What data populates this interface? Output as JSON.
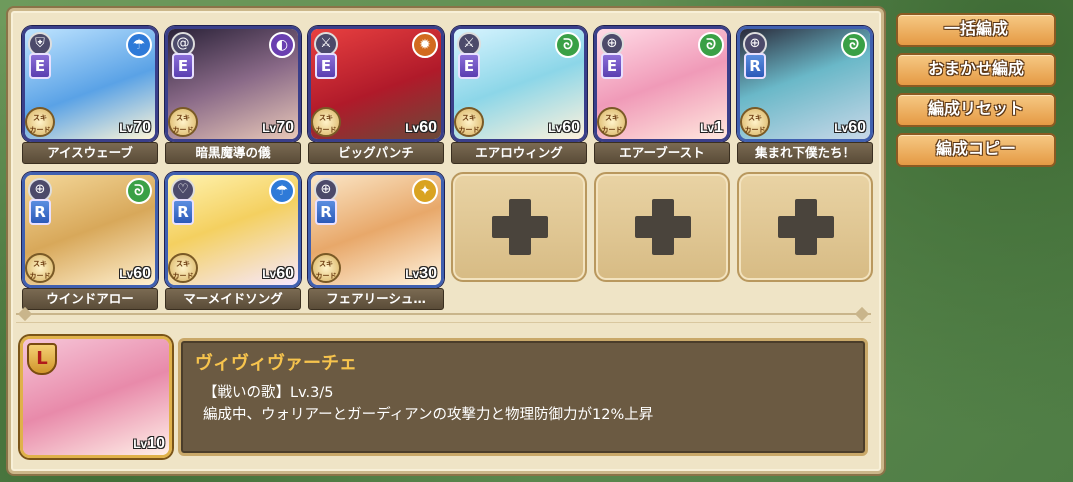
{
  "members": [
    {
      "name": "アイスウェーブ",
      "rank": "E",
      "element_color": "#2e7ad8",
      "element_icon": "water-icon",
      "level_prefix": "Lv",
      "level": "70",
      "skillcard": "スキル\nカード"
    },
    {
      "name": "暗黒魔導の儀",
      "rank": "E",
      "element_color": "#6a3fb0",
      "element_icon": "dark-icon",
      "level_prefix": "Lv",
      "level": "70",
      "skillcard": "スキル\nカード"
    },
    {
      "name": "ビッグパンチ",
      "rank": "E",
      "element_color": "#d26a1e",
      "element_icon": "fire-icon",
      "level_prefix": "Lv",
      "level": "60",
      "skillcard": "スキル\nカード"
    },
    {
      "name": "エアロウィング",
      "rank": "E",
      "element_color": "#3aa046",
      "element_icon": "wind-icon",
      "level_prefix": "Lv",
      "level": "60",
      "skillcard": "スキル\nカード"
    },
    {
      "name": "エアーブースト",
      "rank": "E",
      "element_color": "#3aa046",
      "element_icon": "wind-icon",
      "level_prefix": "Lv",
      "level": "1",
      "skillcard": "スキル\nカード"
    },
    {
      "name": "集まれ下僕たち！",
      "rank": "R",
      "element_color": "#3aa046",
      "element_icon": "wind-icon",
      "level_prefix": "Lv",
      "level": "60",
      "skillcard": "スキル\nカード"
    },
    {
      "name": "ウインドアロー",
      "rank": "R",
      "element_color": "#3aa046",
      "element_icon": "wind-icon",
      "level_prefix": "Lv",
      "level": "60",
      "skillcard": "スキル\nカード"
    },
    {
      "name": "マーメイドソング",
      "rank": "R",
      "element_color": "#2e7ad8",
      "element_icon": "water-icon",
      "level_prefix": "Lv",
      "level": "60",
      "skillcard": "スキル\nカード"
    },
    {
      "name": "フェアリーシュ…",
      "rank": "R",
      "element_color": "#d9a321",
      "element_icon": "light-icon",
      "level_prefix": "Lv",
      "level": "30",
      "skillcard": "スキル\nカード"
    }
  ],
  "buttons": {
    "bulk": "一括編成",
    "auto": "おまかせ編成",
    "reset": "編成リセット",
    "copy": "編成コピー"
  },
  "leader": {
    "badge": "L",
    "level_prefix": "Lv",
    "level": "10",
    "name": "ヴィヴィヴァーチェ",
    "skill_line": "【戦いの歌】Lv.3/5",
    "skill_desc": "編成中、ウォリアーとガーディアンの攻撃力と物理防御力が12%上昇"
  }
}
